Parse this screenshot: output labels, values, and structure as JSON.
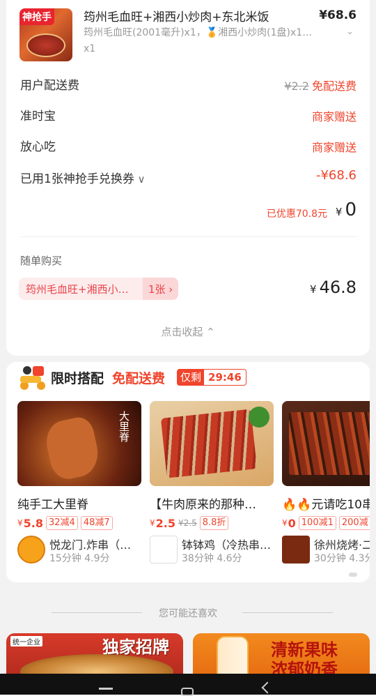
{
  "product": {
    "badge": "神抢手",
    "title": "筠州毛血旺+湘西小炒肉+东北米饭",
    "price": "¥68.6",
    "sub_line1": "筠州毛血旺(2001毫升)x1，🏅湘西小炒肉(1盘)x1…",
    "sub_line2": "x1"
  },
  "fees": {
    "delivery_label": "用户配送费",
    "delivery_old": "¥2.2",
    "delivery_value": "免配送费",
    "ontime_label": "准时宝",
    "ontime_value": "商家赠送",
    "safe_label": "放心吃",
    "safe_value": "商家赠送",
    "coupon_label": "已用1张神抢手兑换券",
    "coupon_value": "-¥68.6",
    "saving_text": "已优惠70.8元",
    "total_yuan": "¥",
    "total_value": "0"
  },
  "addon": {
    "title": "随单购买",
    "item_name": "筠州毛血旺+湘西小炒肉",
    "item_qty": "1张 ›",
    "price_yuan": "¥",
    "price_value": "46.8"
  },
  "collapse_label": "点击收起 ⌃",
  "combo": {
    "title": "限时搭配",
    "free_label": "免配送费",
    "timer_label": "仅剩",
    "timer_value": "29:46",
    "items": [
      {
        "name": "纯手工大里脊",
        "yuan": "¥",
        "price": "5.8",
        "old": "",
        "tag1": "32减4",
        "tag2": "48减7",
        "shop": "悦龙门.炸串（…",
        "meta": "15分钟  4.9分",
        "pic_text": "大里脊"
      },
      {
        "name": "【牛肉原来的那种…",
        "yuan": "¥",
        "price": "2.5",
        "old": "¥2.5",
        "tag1": "8.8折",
        "tag2": "",
        "shop": "钵钵鸡（冷热串…",
        "meta": "38分钟  4.6分",
        "pic_text": ""
      },
      {
        "name": "🔥🔥元请吃10串",
        "yuan": "¥",
        "price": "0",
        "old": "",
        "tag1": "100减1",
        "tag2": "200减",
        "shop": "徐州烧烤·二",
        "meta": "30分钟  4.3分",
        "pic_text": ""
      }
    ]
  },
  "more": {
    "title": "您可能还喜欢",
    "banner1_text": "独家招牌",
    "banner1_tag": "统一企业",
    "banner2_text1": "清新果味",
    "banner2_text2": "浓郁奶香"
  },
  "colors": {
    "accent": "#f0442c",
    "background": "#f2f2f2"
  }
}
